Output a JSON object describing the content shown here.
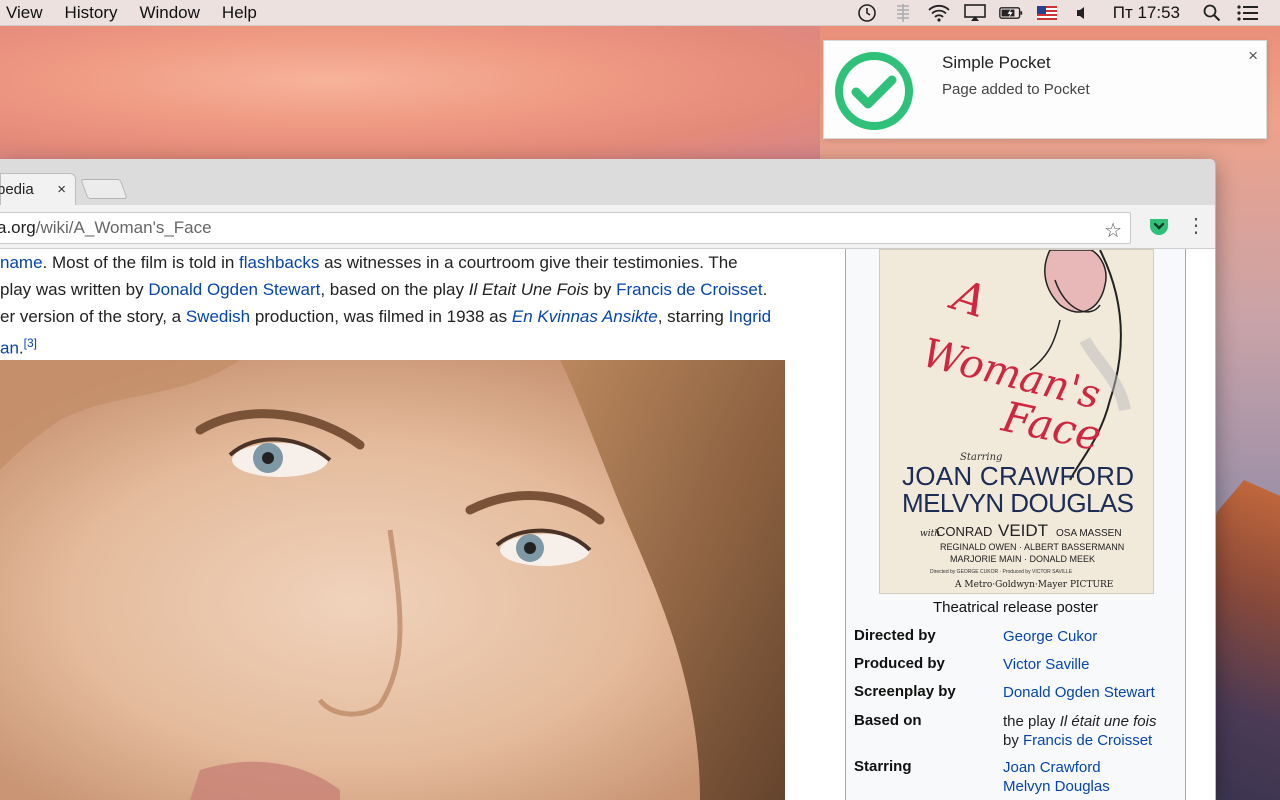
{
  "menubar": {
    "items": [
      "View",
      "History",
      "Window",
      "Help"
    ],
    "clock": "Пт 17:53"
  },
  "notification": {
    "title": "Simple Pocket",
    "message": "Page added to Pocket",
    "close": "×"
  },
  "browser": {
    "tab_title": "pedia",
    "tab_close": "×",
    "url_host": "a.org",
    "url_path": "/wiki/A_Woman's_Face"
  },
  "article": {
    "line1": {
      "link1": "name",
      "text1": ". Most of the film is told in ",
      "link2": "flashbacks",
      "text2": " as witnesses in a courtroom give their testimonies. The"
    },
    "line2": {
      "text1": "play was written by ",
      "link1": "Donald Ogden Stewart",
      "text2": ", based on the play ",
      "italic": "Il Etait Une Fois",
      "text3": " by ",
      "link2": "Francis de Croisset",
      "text4": "."
    },
    "line3": {
      "text1": "er version of the story, a ",
      "link1": "Swedish",
      "text2": " production, was filmed in 1938 as ",
      "link2": "En Kvinnas Ansikte",
      "text3": ", starring ",
      "link3": "Ingrid"
    },
    "line4": {
      "link1": "an",
      "text1": ".",
      "ref": "[3]"
    }
  },
  "infobox": {
    "poster_text": {
      "title_a": "A",
      "title_womans": "Woman's",
      "title_face": "Face",
      "starring": "Starring",
      "star1": "JOAN CRAWFORD",
      "star2": "MELVYN DOUGLAS",
      "cast_line1_with": "with",
      "cast_line1_a": "CONRAD",
      "cast_line1_b": "VEIDT",
      "cast_line1_c": "OSA MASSEN",
      "cast_line2": "REGINALD OWEN · ALBERT BASSERMANN",
      "cast_line3": "MARJORIE MAIN · DONALD MEEK",
      "credits_small": "Directed by GEORGE CUKOR · Produced by VICTOR SAVILLE",
      "studio": "A Metro·Goldwyn·Mayer PICTURE"
    },
    "caption": "Theatrical release poster",
    "rows": [
      {
        "label": "Directed by",
        "value": "George Cukor"
      },
      {
        "label": "Produced by",
        "value": "Victor Saville"
      },
      {
        "label": "Screenplay by",
        "value": "Donald Ogden Stewart"
      },
      {
        "label": "Based on",
        "value_plain1": "the play ",
        "value_italic": "Il était une fois",
        "value_plain2": "by ",
        "value_link": "Francis de Croisset"
      },
      {
        "label": "Starring",
        "value": "Joan Crawford",
        "value2": "Melvyn Douglas"
      }
    ]
  },
  "colors": {
    "link": "#0645ad",
    "pocket_green": "#2fc179"
  }
}
